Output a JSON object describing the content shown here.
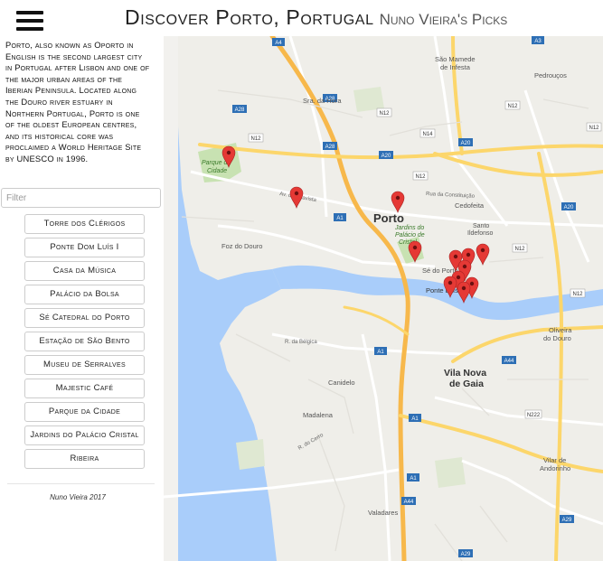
{
  "header": {
    "title": "Discover Porto, Portugal",
    "subtitle": "Nuno Vieira's Picks"
  },
  "sidebar": {
    "description": "Porto, also known as Oporto in English is the second largest city in Portugal after Lisbon and one of the major urban areas of the Iberian Peninsula. Located along the Douro river estuary in Northern Portugal, Porto is one of the oldest European centres, and its historical core was proclaimed a World Heritage Site by UNESCO in 1996.",
    "filter_placeholder": "Filter",
    "places": [
      "Torre dos Clérigos",
      "Ponte Dom Luís I",
      "Casa da Música",
      "Palácio da Bolsa",
      "Sé Catedral do Porto",
      "Estação de São Bento",
      "Museu de Serralves",
      "Majestic Café",
      "Parque da Cidade",
      "Jardins do Palácio Cristal",
      "Ribeira"
    ],
    "footer": "Nuno Vieira 2017"
  },
  "map": {
    "labels": {
      "porto": "Porto",
      "vila_nova_de_gaia": "Vila Nova\nde Gaia",
      "parque_da_cidade": "Parque da\nCidade",
      "foz_do_douro": "Foz do Douro",
      "sao_mamede": "São Mamede\nde Infesta",
      "sra_da_hora": "Sra. da Hora",
      "pedroucos": "Pedrouços",
      "cedofeita": "Cedofeita",
      "santo_ildefonso": "Santo\nIldefonso",
      "jardins": "Jardins do\nPalácio de\nCristal",
      "se_do_porto": "Sé do Porto",
      "ponte_luis": "Ponte Luís I",
      "canidelo": "Canidelo",
      "madalena": "Madalena",
      "oliveira_do_douro": "Oliveira\ndo Douro",
      "vilar_de_andorinho": "Vilar de\nAndorinho",
      "valadares": "Valadares",
      "av_boavista": "Av. da Boavista",
      "rua_da_constituicao": "Rua da Constituição",
      "r_da_bela": "R. da Bélgica",
      "r_do_cerro": "R. do Cerro"
    },
    "road_badges": [
      "A4",
      "N12",
      "A28",
      "N14",
      "A3",
      "N12",
      "N12",
      "A20",
      "A20",
      "N12",
      "A20",
      "A1",
      "A28",
      "N12",
      "A1",
      "A44",
      "A1",
      "N222",
      "A1",
      "A44",
      "A29",
      "A29",
      "A28",
      "N12",
      "N12"
    ],
    "pin_color": "#e53935"
  }
}
